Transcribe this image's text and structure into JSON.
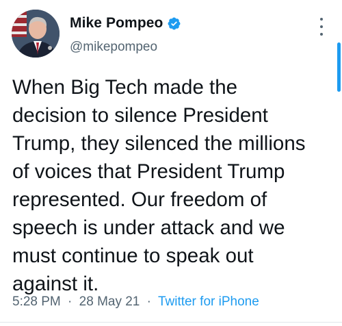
{
  "author": {
    "display_name": "Mike Pompeo",
    "handle": "@mikepompeo",
    "verified": true,
    "avatar_icon": "profile-photo"
  },
  "tweet": {
    "lines": [
      "When Big Tech made the",
      "decision to silence President",
      "Trump, they silenced the millions",
      "of voices that President Trump",
      "represented. Our freedom of",
      "speech is under attack and we",
      "must continue to speak out",
      "against it."
    ],
    "time": "5:28 PM",
    "date": "28 May 21",
    "source": "Twitter for iPhone",
    "separator": "·"
  },
  "colors": {
    "accent": "#1d9bf0",
    "text": "#0f1419",
    "secondary": "#536471"
  },
  "icons": {
    "more": "more-vertical-icon",
    "verified": "verified-badge-icon"
  }
}
